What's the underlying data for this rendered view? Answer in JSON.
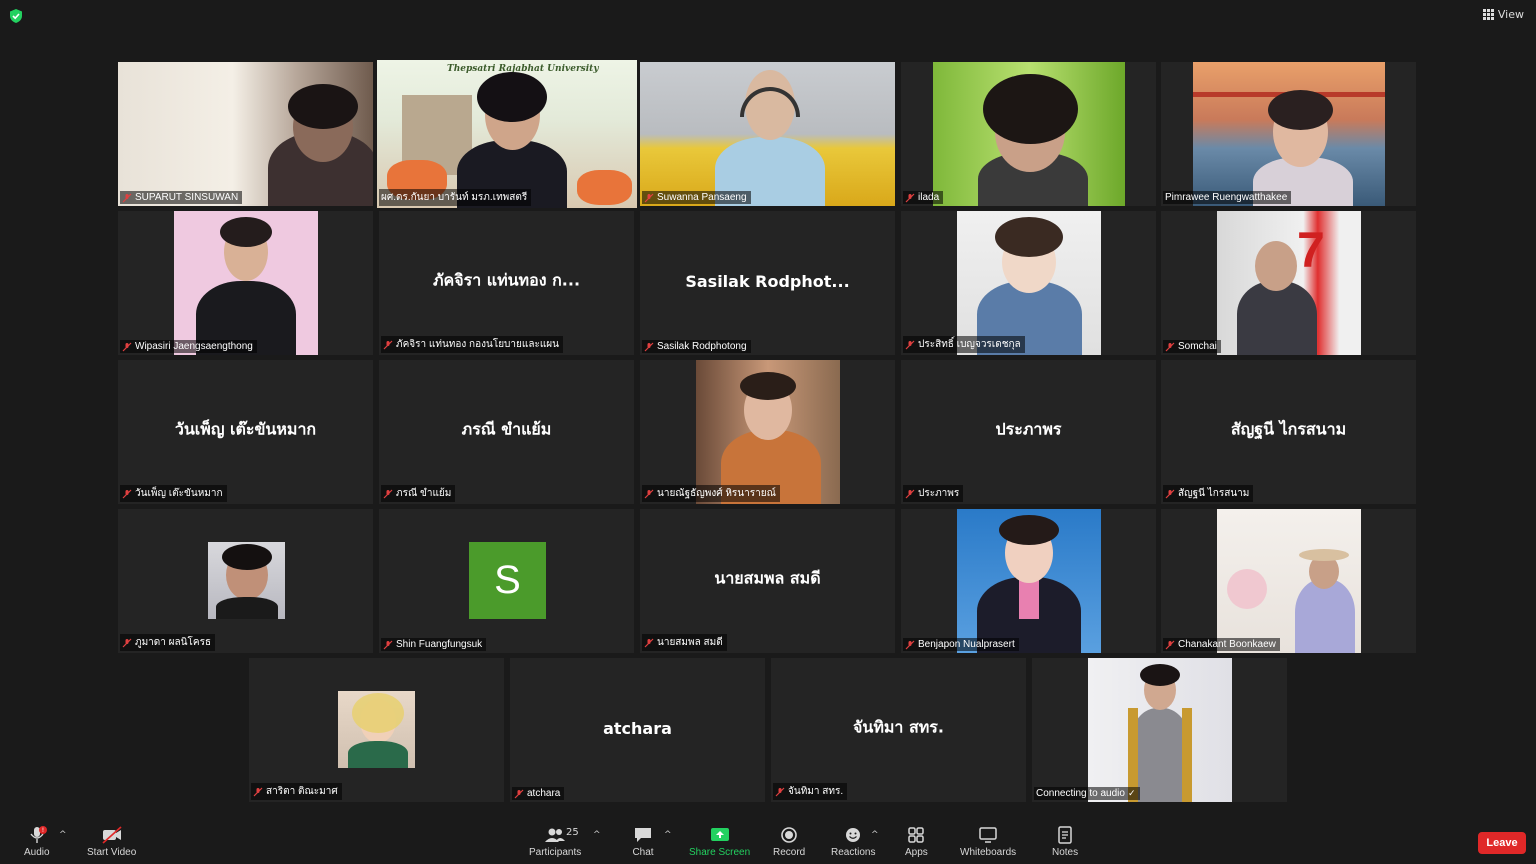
{
  "window": {
    "view_label": "View"
  },
  "participants": [
    {
      "name": "SUPARUT SINSUWAN",
      "center": "",
      "video": true
    },
    {
      "name": "ผศ.ดร.กันยา บารันท์ มรภ.เทพสตรี",
      "center": "",
      "video": true,
      "speaking": true,
      "banner": "Thepsatri Rajabhat University"
    },
    {
      "name": "Suwanna Pansaeng",
      "center": "",
      "video": true
    },
    {
      "name": "ilada",
      "center": "",
      "video": true
    },
    {
      "name": "Pimrawee Ruengwatthakee",
      "center": "",
      "video": true
    },
    {
      "name": "Wipasiri Jaengsaengthong",
      "center": "",
      "video": true
    },
    {
      "name": "ภัคจิรา แท่นทอง กองนโยบายและแผน",
      "center": "ภัคจิรา แท่นทอง ก...",
      "video": false
    },
    {
      "name": "Sasilak Rodphotong",
      "center": "Sasilak  Rodphot...",
      "video": false
    },
    {
      "name": "ประสิทธิ์ เบญจวรเดชกุล",
      "center": "",
      "video": true
    },
    {
      "name": "Somchai",
      "center": "",
      "video": true
    },
    {
      "name": "วันเพ็ญ เต๊ะขันหมาก",
      "center": "วันเพ็ญ เต๊ะขันหมาก",
      "video": false
    },
    {
      "name": "ภรณี ขำแย้ม",
      "center": "ภรณี ขำแย้ม",
      "video": false
    },
    {
      "name": "นายณัฐธัญพงศ์ หิรนารายณ์",
      "center": "",
      "video": true
    },
    {
      "name": "ประภาพร",
      "center": "ประภาพร",
      "video": false
    },
    {
      "name": "สัญฐนี  ไกรสนาม",
      "center": "สัญฐนี  ไกรสนาม",
      "video": false
    },
    {
      "name": "ภูมาดา ผลนิโครธ",
      "center": "",
      "video": false,
      "avatar": "photo"
    },
    {
      "name": "Shin Fuangfungsuk",
      "center": "",
      "video": false,
      "avatar": "S"
    },
    {
      "name": "นายสมพล  สมดี",
      "center": "นายสมพล  สมดี",
      "video": false
    },
    {
      "name": "Benjapon Nualprasert",
      "center": "",
      "video": true
    },
    {
      "name": "Chanakant Boonkaew",
      "center": "",
      "video": true
    },
    {
      "name": "สาริตา ติณะมาศ",
      "center": "",
      "video": false,
      "avatar": "photo"
    },
    {
      "name": "atchara",
      "center": "atchara",
      "video": false
    },
    {
      "name": "จันทิมา สทร.",
      "center": "จันทิมา สทร.",
      "video": false
    },
    {
      "name": "Connecting to audio",
      "center": "",
      "video": true,
      "connecting": true
    }
  ],
  "toolbar": {
    "audio": "Audio",
    "start_video": "Start Video",
    "participants": "Participants",
    "participants_count": "25",
    "chat": "Chat",
    "share_screen": "Share Screen",
    "record": "Record",
    "reactions": "Reactions",
    "apps": "Apps",
    "whiteboards": "Whiteboards",
    "notes": "Notes",
    "leave": "Leave",
    "audio_badge": "!"
  },
  "colors": {
    "speaking_border": "#e6f05a",
    "share": "#23d160",
    "leave": "#e02828",
    "avatar_s": "#4b9b2b"
  }
}
